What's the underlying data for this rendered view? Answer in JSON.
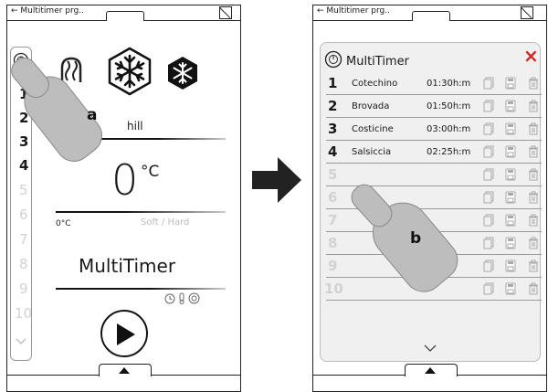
{
  "left_screen": {
    "title": "← Multitimer prg..",
    "sidebar_numbers": [
      "1",
      "2",
      "3",
      "4",
      "5",
      "6",
      "7",
      "8",
      "9",
      "10"
    ],
    "mode_text": "hill",
    "temperature": "0",
    "temperature_unit": "°C",
    "temp_scale_left": "0°C",
    "temp_scale_right": "Soft / Hard",
    "program_name": "MultiTimer",
    "callout": "a"
  },
  "right_screen": {
    "title": "← Multitimer prg..",
    "panel_title": "MultiTimer",
    "close": "×",
    "rows": [
      {
        "num": "1",
        "name": "Cotechino",
        "time": "01:30h:m"
      },
      {
        "num": "2",
        "name": "Brovada",
        "time": "01:50h:m"
      },
      {
        "num": "3",
        "name": "Costicine",
        "time": "03:00h:m"
      },
      {
        "num": "4",
        "name": "Salsiccia",
        "time": "02:25h:m"
      },
      {
        "num": "5",
        "name": "",
        "time": ""
      },
      {
        "num": "6",
        "name": "",
        "time": ""
      },
      {
        "num": "7",
        "name": "",
        "time": ""
      },
      {
        "num": "8",
        "name": "",
        "time": ""
      },
      {
        "num": "9",
        "name": "",
        "time": ""
      },
      {
        "num": "10",
        "name": "",
        "time": ""
      }
    ],
    "callout": "b"
  },
  "icons": [
    "back-arrow-icon",
    "multitimer-icon",
    "heat-wave-icon",
    "snowflake-icon",
    "play-icon",
    "copy-icon",
    "save-icon",
    "trash-icon",
    "close-icon",
    "chevron-down-icon"
  ]
}
